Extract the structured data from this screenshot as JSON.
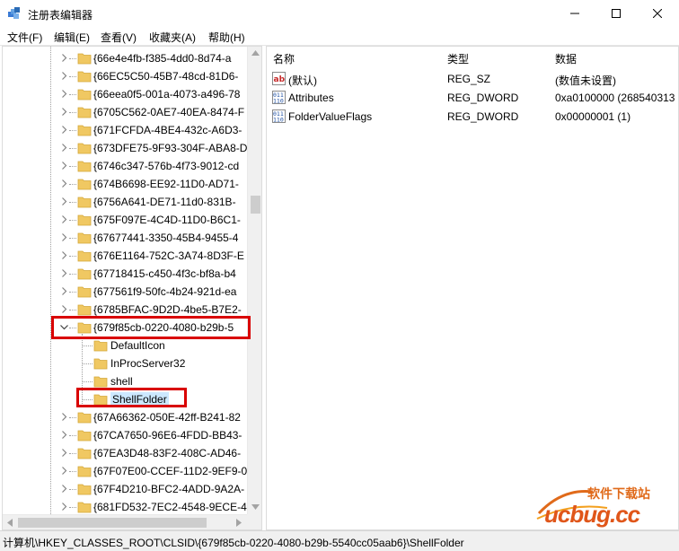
{
  "window": {
    "title": "注册表编辑器",
    "icon": "regedit-icon"
  },
  "menu": [
    "文件(F)",
    "编辑(E)",
    "查看(V)",
    "收藏夹(A)",
    "帮助(H)"
  ],
  "tree": {
    "items": [
      {
        "label": "{66e4e4fb-f385-4dd0-8d74-a"
      },
      {
        "label": "{66EC5C50-45B7-48cd-81D6-"
      },
      {
        "label": "{66eea0f5-001a-4073-a496-78"
      },
      {
        "label": "{6705C562-0AE7-40EA-8474-F"
      },
      {
        "label": "{671FCFDA-4BE4-432c-A6D3-"
      },
      {
        "label": "{673DFE75-9F93-304F-ABA8-D"
      },
      {
        "label": "{6746c347-576b-4f73-9012-cd"
      },
      {
        "label": "{674B6698-EE92-11D0-AD71-"
      },
      {
        "label": "{6756A641-DE71-11d0-831B-"
      },
      {
        "label": "{675F097E-4C4D-11D0-B6C1-"
      },
      {
        "label": "{67677441-3350-45B4-9455-4"
      },
      {
        "label": "{676E1164-752C-3A74-8D3F-E"
      },
      {
        "label": "{67718415-c450-4f3c-bf8a-b4"
      },
      {
        "label": "{677561f9-50fc-4b24-921d-ea"
      },
      {
        "label": "{6785BFAC-9D2D-4be5-B7E2-"
      },
      {
        "label": "{679f85cb-0220-4080-b29b-5"
      },
      {
        "label": "DefaultIcon"
      },
      {
        "label": "InProcServer32"
      },
      {
        "label": "shell"
      },
      {
        "label": "ShellFolder"
      },
      {
        "label": "{67A66362-050E-42ff-B241-82"
      },
      {
        "label": "{67CA7650-96E6-4FDD-BB43-"
      },
      {
        "label": "{67EA3D48-83F2-408C-AD46-"
      },
      {
        "label": "{67F07E00-CCEF-11D2-9EF9-0"
      },
      {
        "label": "{67F4D210-BFC2-4ADD-9A2A-"
      },
      {
        "label": "{681FD532-7EC2-4548-9ECE-4"
      }
    ]
  },
  "list": {
    "columns": [
      "名称",
      "类型",
      "数据"
    ],
    "rows": [
      {
        "icon": "string-value-icon",
        "name": "(默认)",
        "type": "REG_SZ",
        "data": "(数值未设置)"
      },
      {
        "icon": "dword-value-icon",
        "name": "Attributes",
        "type": "REG_DWORD",
        "data": "0xa0100000 (268540313"
      },
      {
        "icon": "dword-value-icon",
        "name": "FolderValueFlags",
        "type": "REG_DWORD",
        "data": "0x00000001 (1)"
      }
    ]
  },
  "status": {
    "path": "计算机\\HKEY_CLASSES_ROOT\\CLSID\\{679f85cb-0220-4080-b29b-5540cc05aab6}\\ShellFolder"
  },
  "watermark": {
    "top_text": "软件下载站",
    "brand": "ucbug.cc"
  },
  "colors": {
    "highlight": "#d90000",
    "folder": "#f0c862",
    "selection": "#cce8ff"
  }
}
